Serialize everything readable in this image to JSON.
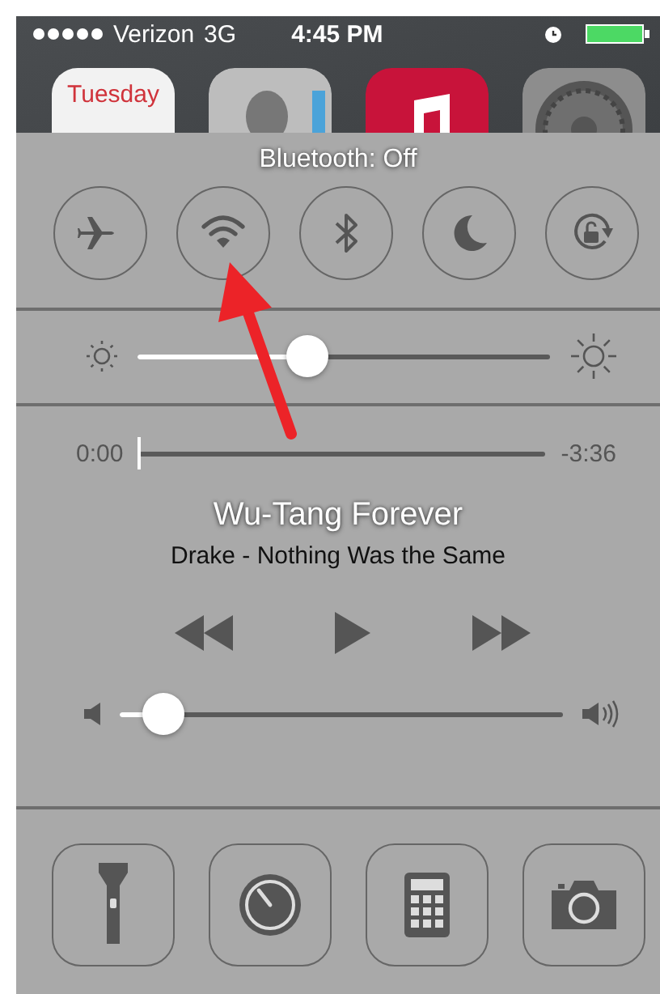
{
  "status_bar": {
    "carrier": "Verizon",
    "network": "3G",
    "time": "4:45 PM"
  },
  "home_apps": [
    {
      "kind": "calendar",
      "label": "Tuesday"
    },
    {
      "kind": "contacts"
    },
    {
      "kind": "music"
    },
    {
      "kind": "settings"
    }
  ],
  "control_center": {
    "message": "Bluetooth: Off",
    "toggles": [
      {
        "kind": "airplane",
        "on": false
      },
      {
        "kind": "wifi",
        "on": false
      },
      {
        "kind": "bluetooth",
        "on": false
      },
      {
        "kind": "moon",
        "on": false
      },
      {
        "kind": "rotation_lock",
        "on": false
      }
    ],
    "brightness": {
      "level": 0.41
    },
    "now_playing": {
      "elapsed": "0:00",
      "remaining": "-3:36",
      "progress": {
        "level": 0
      },
      "title": "Wu-Tang Forever",
      "subtitle": "Drake - Nothing Was the Same",
      "volume": {
        "level": 0.1
      }
    },
    "shortcuts": [
      {
        "kind": "flashlight"
      },
      {
        "kind": "timer"
      },
      {
        "kind": "calculator"
      },
      {
        "kind": "camera"
      }
    ]
  },
  "annotation": {
    "kind": "arrow"
  }
}
